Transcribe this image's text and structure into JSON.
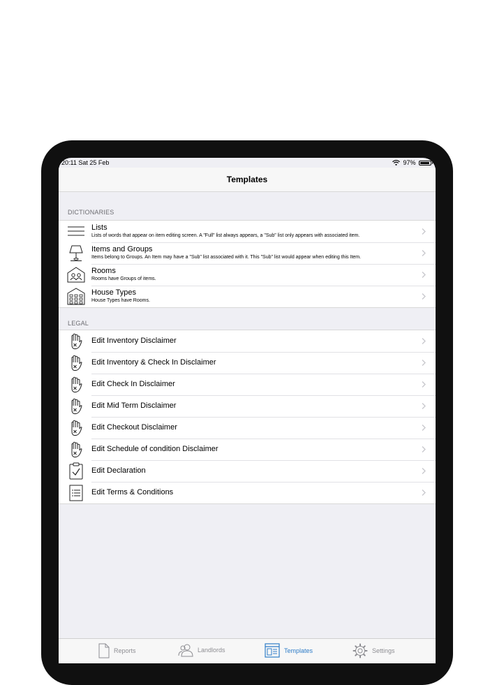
{
  "status_bar": {
    "time_date": "20:11  Sat 25 Feb",
    "battery": "97%",
    "battery_level": 0.97
  },
  "nav": {
    "title": "Templates"
  },
  "dictionaries": {
    "header": "DICTIONARIES",
    "items": [
      {
        "title": "Lists",
        "subtitle": "Lists of words that appear on item editing screen. A \"Full\" list always appears, a \"Sub\" list only appears with associated item.",
        "icon": "list-lines-icon"
      },
      {
        "title": "Items and Groups",
        "subtitle": "Items belong to Groups. An Item may have a \"Sub\" list associated with it. This \"Sub\" list would appear when editing this Item.",
        "icon": "lamp-icon"
      },
      {
        "title": "Rooms",
        "subtitle": "Rooms have Groups of items.",
        "icon": "room-people-icon"
      },
      {
        "title": "House Types",
        "subtitle": "House Types have Rooms.",
        "icon": "building-icon"
      }
    ]
  },
  "legal": {
    "header": "LEGAL",
    "items": [
      {
        "title": "Edit Inventory Disclaimer",
        "icon": "hand-x-icon"
      },
      {
        "title": "Edit Inventory & Check In Disclaimer",
        "icon": "hand-x-icon"
      },
      {
        "title": "Edit Check In Disclaimer",
        "icon": "hand-x-icon"
      },
      {
        "title": "Edit Mid Term Disclaimer",
        "icon": "hand-x-icon"
      },
      {
        "title": "Edit Checkout Disclaimer",
        "icon": "hand-x-icon"
      },
      {
        "title": "Edit Schedule of condition Disclaimer",
        "icon": "hand-x-icon"
      },
      {
        "title": "Edit Declaration",
        "icon": "clipboard-check-icon"
      },
      {
        "title": "Edit Terms & Conditions",
        "icon": "document-list-icon"
      }
    ]
  },
  "tabs": [
    {
      "label": "Reports",
      "icon": "document-icon",
      "active": false
    },
    {
      "label": "Landlords",
      "icon": "people-icon",
      "active": false
    },
    {
      "label": "Templates",
      "icon": "template-icon",
      "active": true
    },
    {
      "label": "Settings",
      "icon": "gear-icon",
      "active": false
    }
  ],
  "colors": {
    "accent": "#2f7dc8",
    "background": "#efeff4",
    "inactive_tab": "#8e8e93"
  }
}
